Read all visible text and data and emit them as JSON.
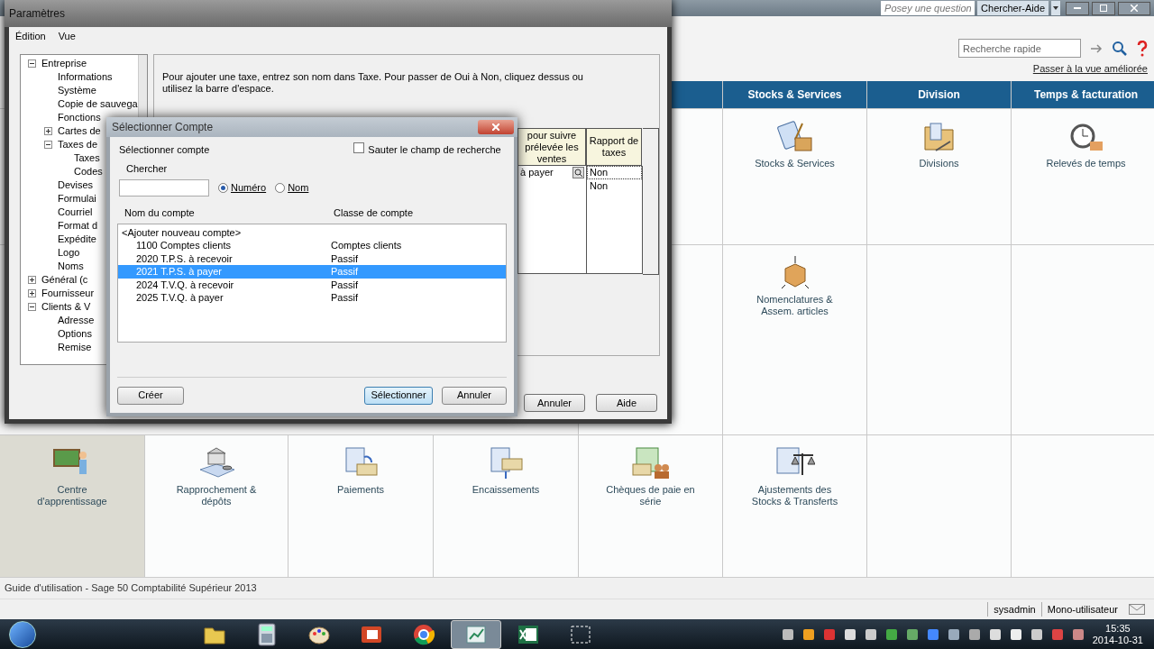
{
  "app": {
    "help_search": {
      "placeholder": "Posey une question"
    },
    "help_button": "Chercher-Aide",
    "quick_search": {
      "placeholder": "Recherche rapide"
    },
    "view_link": "Passer à la vue améliorée",
    "headers": [
      "Stocks & Services",
      "Division",
      "Temps & facturation"
    ],
    "top_tiles": [
      {
        "kind": "stock",
        "label": "Stocks & Services"
      },
      {
        "kind": "folder",
        "label": "Divisions"
      },
      {
        "kind": "clock",
        "label": "Relevés de temps"
      }
    ],
    "middle_tiles": [
      {
        "kind": "assembly",
        "label": "Nomenclatures & Assem. articles"
      }
    ],
    "bottom_tiles": [
      {
        "kind": "teacher",
        "label": "Centre d'apprentissage",
        "highlighted": true
      },
      {
        "kind": "bank",
        "label": "Rapprochement & dépôts",
        "highlighted": false
      },
      {
        "kind": "payment",
        "label": "Paiements",
        "highlighted": false
      },
      {
        "kind": "receipt",
        "label": "Encaissements",
        "highlighted": false
      },
      {
        "kind": "payroll",
        "label": "Chèques de paie en série",
        "highlighted": false
      },
      {
        "kind": "scale",
        "label": "Ajustements des Stocks & Transferts",
        "highlighted": false
      }
    ],
    "status_bar": "Guide d'utilisation - Sage 50 Comptabilité Supérieur 2013",
    "user": "sysadmin",
    "mode": "Mono-utilisateur"
  },
  "settings_window": {
    "title": "Paramètres",
    "menu": [
      "Édition",
      "Vue"
    ],
    "tree": [
      {
        "label": "Entreprise",
        "expanded": true,
        "children": [
          {
            "label": "Informations"
          },
          {
            "label": "Système"
          },
          {
            "label": "Copie de sauvega"
          },
          {
            "label": "Fonctions"
          },
          {
            "label": "Cartes de",
            "expanded": false
          },
          {
            "label": "Taxes de",
            "expanded": true,
            "children": [
              {
                "label": "Taxes"
              },
              {
                "label": "Codes"
              }
            ]
          },
          {
            "label": "Devises"
          },
          {
            "label": "Formulai"
          },
          {
            "label": "Courriel"
          },
          {
            "label": "Format d"
          },
          {
            "label": "Expédite"
          },
          {
            "label": "Logo"
          },
          {
            "label": "Noms"
          }
        ]
      },
      {
        "label": "Général (c",
        "expanded": false
      },
      {
        "label": "Fournisseur",
        "expanded": false
      },
      {
        "label": "Clients & V",
        "expanded": true,
        "children": [
          {
            "label": "Adresse"
          },
          {
            "label": "Options"
          },
          {
            "label": "Remise"
          }
        ]
      }
    ],
    "instructions": "Pour ajouter une taxe, entrez son nom dans Taxe. Pour passer de Oui à Non, cliquez dessus ou utilisez la barre d'espace.",
    "table": {
      "columns": [
        "pour suivre prélevée les ventes",
        "Rapport de taxes"
      ],
      "rows": [
        {
          "account": "à payer",
          "report": "Non",
          "focused": true
        },
        {
          "report": "Non",
          "focused": false
        }
      ]
    },
    "buttons": [
      "Annuler",
      "Aide"
    ]
  },
  "account_dialog": {
    "title": "Sélectionner Compte",
    "select_label": "Sélectionner compte",
    "search_label": "Chercher",
    "search_by": [
      {
        "label": "Numéro",
        "selected": true
      },
      {
        "label": "Nom",
        "selected": false
      }
    ],
    "skip_search": {
      "label": "Sauter le champ de recherche",
      "checked": false
    },
    "columns": [
      "Nom du compte",
      "Classe de compte"
    ],
    "rows": [
      {
        "name": "<Ajouter nouveau compte>",
        "selected": false
      },
      {
        "name": "1100 Comptes clients",
        "class": "Comptes clients",
        "selected": false
      },
      {
        "name": "2020 T.P.S. à recevoir",
        "class": "Passif",
        "selected": false
      },
      {
        "name": "2021 T.P.S. à payer",
        "class": "Passif",
        "selected": true
      },
      {
        "name": "2024 T.V.Q. à recevoir",
        "class": "Passif",
        "selected": false
      },
      {
        "name": "2025 T.V.Q. à payer",
        "class": "Passif",
        "selected": false
      }
    ],
    "buttons": {
      "create": "Créer",
      "select": "Sélectionner",
      "cancel": "Annuler"
    }
  },
  "taskbar": {
    "apps": [
      {
        "kind": "folder",
        "active": false
      },
      {
        "kind": "calculator",
        "active": false
      },
      {
        "kind": "paint",
        "active": false
      },
      {
        "kind": "slides",
        "active": false
      },
      {
        "kind": "browser",
        "active": false
      },
      {
        "kind": "ledger",
        "active": true
      },
      {
        "kind": "sheet",
        "active": false
      },
      {
        "kind": "snip",
        "active": false
      }
    ],
    "time": "15:35",
    "date": "2014-10-31"
  }
}
